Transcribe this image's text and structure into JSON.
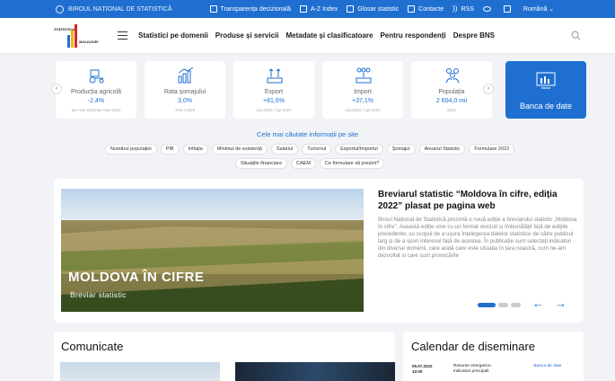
{
  "topbar": {
    "brand": "BIROUL NAȚIONAL DE STATISTICĂ",
    "links": [
      {
        "label": "Transparența decizională",
        "icon": "document-icon"
      },
      {
        "label": "A-Z Index",
        "icon": "az-index-icon"
      },
      {
        "label": "Glosar statistic",
        "icon": "glossary-icon"
      },
      {
        "label": "Contacte",
        "icon": "contact-card-icon"
      },
      {
        "label": "RSS",
        "icon": "rss-icon"
      },
      {
        "label": "",
        "icon": "eye-icon"
      },
      {
        "label": "",
        "icon": "sitemap-icon"
      },
      {
        "label": "Română ⌄",
        "icon": ""
      }
    ]
  },
  "header": {
    "logo_line1": "STATISTICA",
    "logo_line2": "MOLDOVEI",
    "nav": [
      "Statistici pe domenii",
      "Produse și servicii",
      "Metadate și clasificatoare",
      "Pentru respondenți",
      "Despre BNS"
    ]
  },
  "indicators": [
    {
      "name": "Producția agricolă",
      "value": "-2,4%",
      "period": "Ian-mar 2022/Ian-mar 2021"
    },
    {
      "name": "Rata șomajului",
      "value": "3,0%",
      "period": "Trim.I 2022"
    },
    {
      "name": "Export",
      "value": "+81,6%",
      "period": "Apr.2022 / Apr.2021"
    },
    {
      "name": "Import",
      "value": "+37,1%",
      "period": "Apr.2022 / Apr.2021"
    },
    {
      "name": "Populația",
      "value": "2 604,0 mii",
      "period": "2021"
    }
  ],
  "data_bank": {
    "label": "Banca de date"
  },
  "popular": {
    "title": "Cele mai căutate informații pe site",
    "chips": [
      "Numărul populației",
      "PIB",
      "Inflația",
      "Minimul de existență",
      "Salariul",
      "Turismul",
      "Exportul/Importul",
      "Șomajul",
      "Anuarul Statistic",
      "Formulare 2022",
      "Situațiile financiare",
      "CAEM",
      "Ce formulare să prezint?"
    ]
  },
  "feature": {
    "image_title": "MOLDOVA ÎN CIFRE",
    "image_subtitle": "Breviar statistic",
    "headline": "Breviarul statistic “Moldova în cifre, ediția 2022” plasat pe pagina web",
    "body": "Biroul Național de Statistică prezintă o nouă ediție a breviarului statistic „Moldova în cifre”. Această ediție vine cu un format revizuit și îmbunătățit față de edițiile precedente, cu scopul de a ușura înțelegerea datelor statistice de către publicul larg și de a spori interesul față de acestea. În publicație sunt selectați indicatori din diverse domenii, care arată care este situația în țara noastră, cum ne-am dezvoltat și care sunt provocările",
    "prev": "←",
    "next": "→"
  },
  "communicates": {
    "title": "Comunicate"
  },
  "calendar": {
    "title": "Calendar de diseminare",
    "date": "05.07.2022",
    "time": "10:00",
    "desc": "Resurse energetice, indicatori principali",
    "link": "Banca de date"
  },
  "colors": {
    "primary": "#1f6fd1",
    "accent": "#1f6fd1",
    "background": "#f1f3f6"
  }
}
